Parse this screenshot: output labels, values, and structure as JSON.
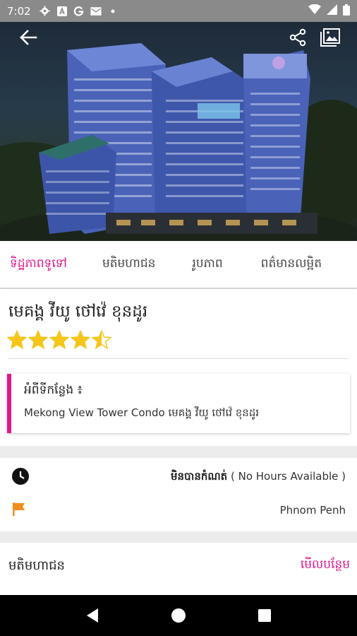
{
  "status_bar": {
    "time": "7:02",
    "icons": [
      "gear-icon",
      "a-icon",
      "g-icon",
      "mail-icon",
      "dot-icon"
    ],
    "right_icons": [
      "wifi-icon",
      "signal-icon",
      "battery-icon"
    ]
  },
  "hero": {
    "back_icon": "arrow-left-icon",
    "share_icon": "share-icon",
    "gallery_icon": "gallery-icon"
  },
  "tabs": [
    {
      "label": "ទិដ្ឋភាពទូទៅ",
      "active": true
    },
    {
      "label": "មតិមហាជន",
      "active": false
    },
    {
      "label": "រូបភាព",
      "active": false
    },
    {
      "label": "ពត៌មានលម្អិត",
      "active": false
    }
  ],
  "place": {
    "title": "មេគង្គ វីយូ ថៅវ៉េ ខុនដូរ",
    "rating": 4.5,
    "max_rating": 5,
    "address_label": "អំពីទីកន្លែង ៖",
    "address_text": "Mekong View Tower Condo មេគង្គ វីយូ ថៅវ៉េ ខុនដូរ"
  },
  "info": {
    "hours_label": "មិនបានកំណត់",
    "hours_note": "( No Hours Available )",
    "location": "Phnom Penh"
  },
  "reviews_section": {
    "title": "មតិមហាជន",
    "more_label": "មើលបន្ថែម"
  },
  "colors": {
    "accent": "#e0178c",
    "flag": "#f28c1e"
  }
}
